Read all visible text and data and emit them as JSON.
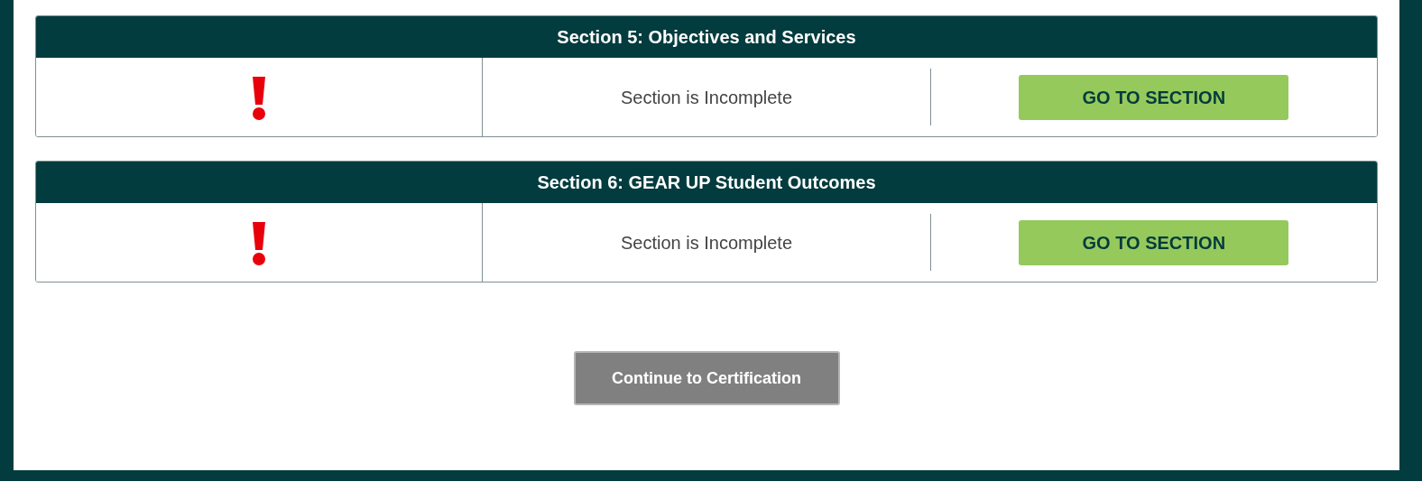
{
  "sections": [
    {
      "title": "Section 5: Objectives and Services",
      "status": {
        "kind": "incomplete",
        "label": "Section is Incomplete"
      },
      "button": "GO TO SECTION"
    },
    {
      "title": "Section 6: GEAR UP Student Outcomes",
      "status": {
        "kind": "incomplete",
        "label": "Section is Incomplete"
      },
      "button": "GO TO SECTION"
    }
  ],
  "continue_button": {
    "label": "Continue to Certification",
    "disabled": true
  }
}
